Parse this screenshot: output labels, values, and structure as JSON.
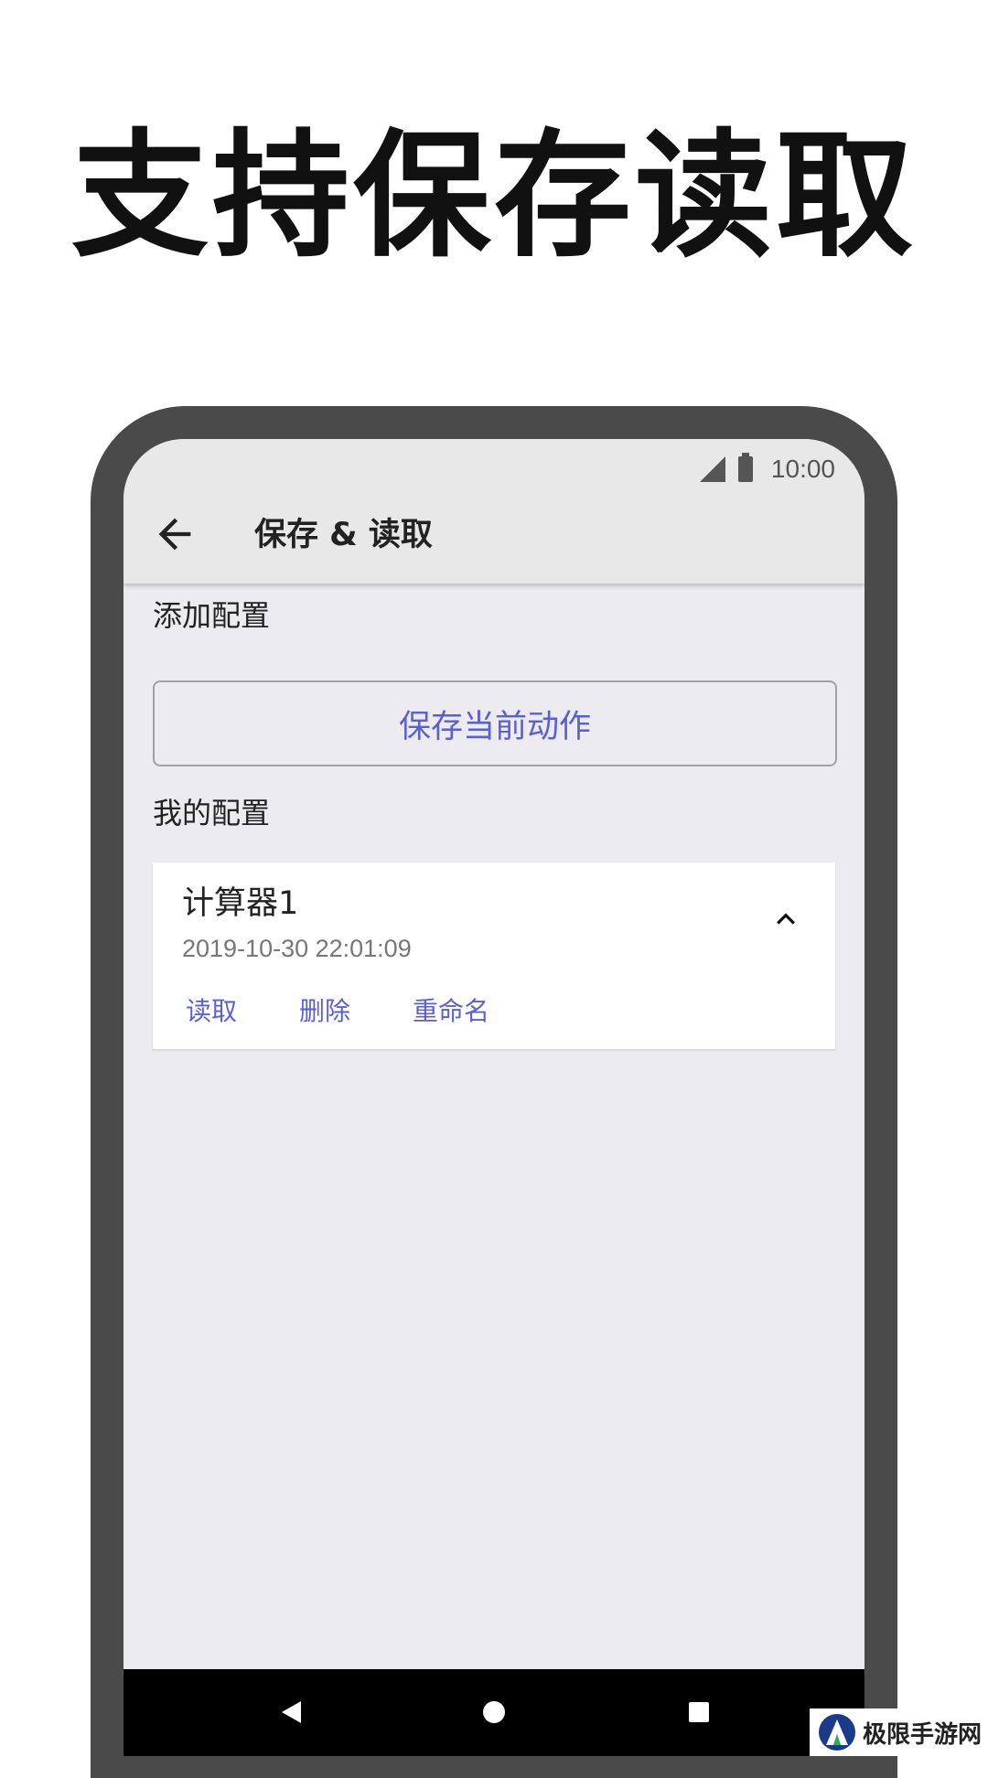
{
  "headline": "支持保存读取",
  "status_bar": {
    "time": "10:00",
    "icons": [
      "signal-icon",
      "battery-icon"
    ]
  },
  "app_bar": {
    "back_icon": "arrow-left-icon",
    "title": "保存 & 读取"
  },
  "add_section": {
    "label": "添加配置",
    "save_button_label": "保存当前动作"
  },
  "my_configs": {
    "label": "我的配置",
    "items": [
      {
        "name": "计算器1",
        "timestamp": "2019-10-30 22:01:09",
        "expanded": true,
        "actions": [
          "读取",
          "删除",
          "重命名"
        ]
      }
    ]
  },
  "nav_bar": {
    "buttons": [
      "back-triangle-icon",
      "home-circle-icon",
      "recents-square-icon"
    ]
  },
  "watermark": {
    "text": "极限手游网"
  },
  "colors": {
    "accent": "#5b5fd6",
    "screen_bg": "#ebebf0",
    "app_bar_bg": "#e8e8e8",
    "frame": "#4a4a4a"
  }
}
